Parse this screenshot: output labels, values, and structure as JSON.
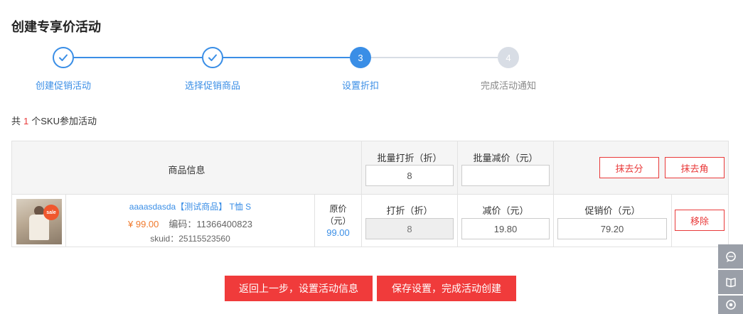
{
  "page": {
    "title": "创建专享价活动"
  },
  "steps": [
    {
      "label": "创建促销活动",
      "state": "done",
      "number": ""
    },
    {
      "label": "选择促销商品",
      "state": "done",
      "number": ""
    },
    {
      "label": "设置折扣",
      "state": "active",
      "number": "3"
    },
    {
      "label": "完成活动通知",
      "state": "pending",
      "number": "4"
    }
  ],
  "summary": {
    "prefix": "共",
    "count": "1",
    "suffix": "个SKU参加活动"
  },
  "table": {
    "header": {
      "goods_info": "商品信息",
      "batch_discount_label": "批量打折（折）",
      "batch_discount_value": "8",
      "batch_reduce_label": "批量减价（元）",
      "batch_reduce_value": "",
      "btn_erase_fen": "抹去分",
      "btn_erase_jiao": "抹去角"
    },
    "rows": [
      {
        "name": "aaaasdasda【测试商品】 T恤 S",
        "price": "¥ 99.00",
        "code": "编码：11366400823",
        "skuid": "skuid：25115523560",
        "orig_label_1": "原价",
        "orig_label_2": "（元）",
        "orig_value": "99.00",
        "discount_label": "打折（折）",
        "discount_value": "8",
        "reduce_label": "减价（元）",
        "reduce_value": "19.80",
        "promo_label": "促销价（元）",
        "promo_value": "79.20",
        "remove_label": "移除",
        "thumb_badge": "sale"
      }
    ]
  },
  "actions": {
    "back_label": "返回上一步，设置活动信息",
    "save_label": "保存设置，完成活动创建"
  },
  "side_tools": [
    {
      "icon": "customer-service-icon"
    },
    {
      "icon": "book-icon"
    },
    {
      "icon": "target-icon"
    }
  ],
  "colors": {
    "primary_blue": "#3a8ee6",
    "accent_red": "#f03b3b",
    "price_orange": "#f07a2d",
    "pending_gray": "#d8dde5"
  }
}
